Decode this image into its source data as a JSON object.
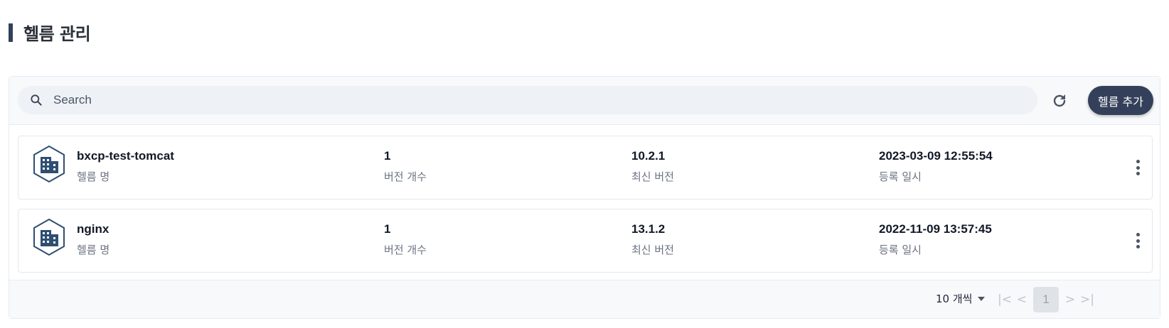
{
  "page": {
    "title": "헬름 관리"
  },
  "toolbar": {
    "search_placeholder": "Search",
    "search_value": "",
    "refresh_icon": "refresh-icon",
    "add_button_label": "헬름 추가"
  },
  "labels": {
    "name": "헬름 명",
    "version_count": "버전 개수",
    "latest_version": "최신 버전",
    "registered_at": "등록 일시"
  },
  "rows": [
    {
      "name": "bxcp-test-tomcat",
      "version_count": "1",
      "latest_version": "10.2.1",
      "registered_at": "2023-03-09 12:55:54"
    },
    {
      "name": "nginx",
      "version_count": "1",
      "latest_version": "13.1.2",
      "registered_at": "2022-11-09 13:57:45"
    }
  ],
  "pagination": {
    "page_size_label": "10 개씩",
    "current_page": "1",
    "first": "|<",
    "prev": "<",
    "next": ">",
    "last": ">|"
  },
  "colors": {
    "accent": "#34405a",
    "icon": "#2f4f72"
  }
}
